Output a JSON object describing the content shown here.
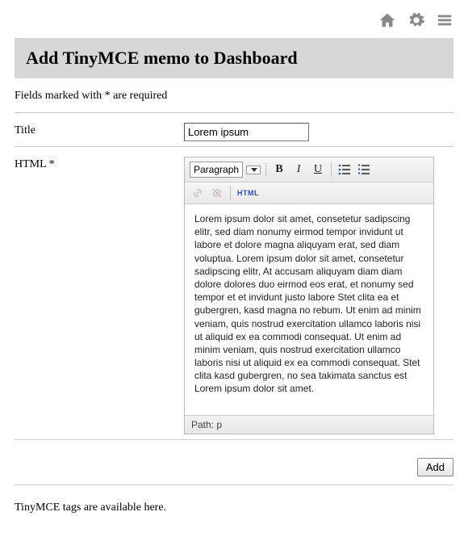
{
  "header": {
    "title": "Add TinyMCE memo to Dashboard"
  },
  "hint": "Fields marked with * are required",
  "form": {
    "title_label": "Title",
    "title_value": "Lorem ipsum",
    "html_label": "HTML *"
  },
  "editor": {
    "format_selected": "Paragraph",
    "bold_glyph": "B",
    "italic_glyph": "I",
    "underline_glyph": "U",
    "html_btn": "HTML",
    "content": "Lorem ipsum dolor sit amet, consetetur sadipscing elitr, sed diam nonumy eirmod tempor invidunt ut labore et dolore magna aliquyam erat, sed diam voluptua. Lorem ipsum dolor sit amet, consetetur sadipscing elitr, At accusam aliquyam diam diam dolore dolores duo eirmod eos erat, et nonumy sed tempor et et invidunt justo labore Stet clita ea et gubergren, kasd magna no rebum. Ut enim ad minim veniam, quis nostrud exercitation ullamco laboris nisi ut aliquid ex ea commodi consequat. Ut enim ad minim veniam, quis nostrud exercitation ullamco laboris nisi ut aliquid ex ea commodi consequat. Stet clita kasd gubergren, no sea takimata sanctus est Lorem ipsum dolor sit amet.",
    "path_label": "Path:",
    "path_value": "p"
  },
  "actions": {
    "add_label": "Add"
  },
  "footer": {
    "tags_note": "TinyMCE tags are available here."
  }
}
